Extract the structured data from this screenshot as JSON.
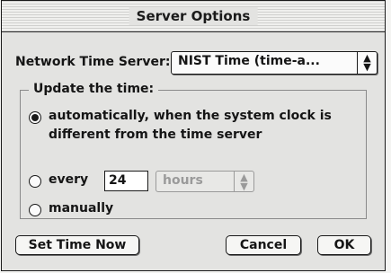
{
  "window": {
    "title": "Server Options"
  },
  "server": {
    "label": "Network Time Server:",
    "selected": "NIST Time (time-a...",
    "arrows": "⇕"
  },
  "update_group": {
    "label": "Update the time:",
    "options": [
      {
        "label_line1": "automatically, when the system clock is",
        "label_line2": "different from the time server",
        "selected": true
      },
      {
        "label": "every",
        "selected": false
      },
      {
        "label": "manually",
        "selected": false
      }
    ],
    "interval_value": "24",
    "interval_unit": "hours"
  },
  "buttons": {
    "set_time_now": "Set Time Now",
    "cancel": "Cancel",
    "ok": "OK"
  }
}
